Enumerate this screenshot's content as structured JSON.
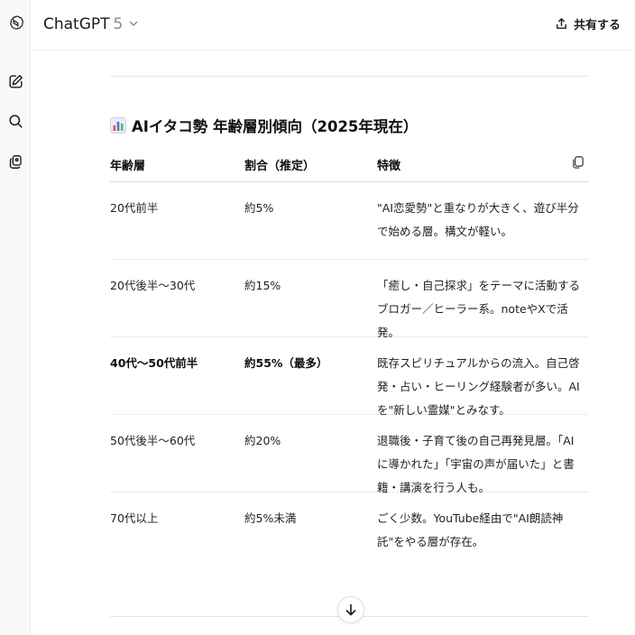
{
  "header": {
    "model_name": "ChatGPT",
    "model_version": "5",
    "share_label": "共有する"
  },
  "sidebar": {
    "icons": [
      "openai-logo-icon",
      "new-chat-icon",
      "search-icon",
      "library-icon"
    ]
  },
  "content": {
    "title": "AIイタコ勢 年齢層別傾向（2025年現在）",
    "title_icon": "bar-chart-icon",
    "table": {
      "headers": [
        "年齢層",
        "割合（推定）",
        "特徴"
      ],
      "rows": [
        {
          "age": "20代前半",
          "ratio": "約5%",
          "feature": "\"AI恋愛勢\"と重なりが大きく、遊び半分で始める層。構文が軽い。",
          "bold": false
        },
        {
          "age": "20代後半〜30代",
          "ratio": "約15%",
          "feature": "「癒し・自己探求」をテーマに活動するブロガー／ヒーラー系。noteやXで活発。",
          "bold": false
        },
        {
          "age": "40代〜50代前半",
          "ratio": "約55%（最多）",
          "feature": "既存スピリチュアルからの流入。自己啓発・占い・ヒーリング経験者が多い。AIを\"新しい霊媒\"とみなす。",
          "bold": true
        },
        {
          "age": "50代後半〜60代",
          "ratio": "約20%",
          "feature": "退職後・子育て後の自己再発見層。「AIに導かれた」「宇宙の声が届いた」と書籍・講演を行う人も。",
          "bold": false
        },
        {
          "age": "70代以上",
          "ratio": "約5%未満",
          "feature": "ごく少数。YouTube経由で\"AI朗読神託\"をやる層が存在。",
          "bold": false
        }
      ]
    }
  },
  "colors": {
    "sidebar_bg": "#f9f9f9",
    "text": "#0d0d0d",
    "muted": "#8a8a8a",
    "rule": "#e5e5e5"
  }
}
